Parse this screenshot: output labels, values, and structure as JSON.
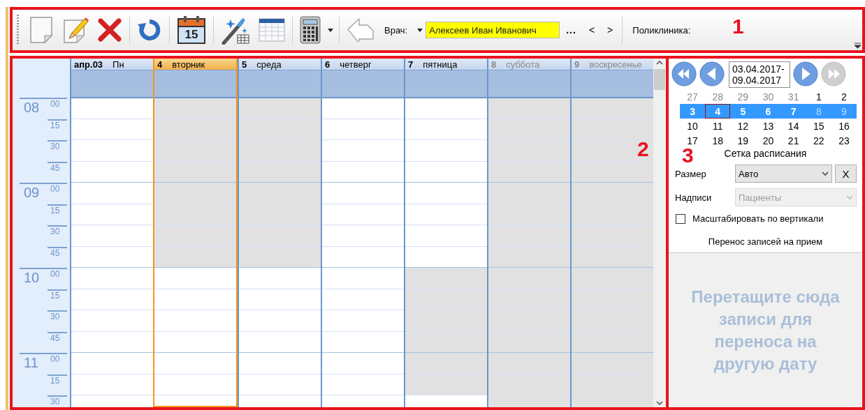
{
  "toolbar": {
    "calendar_day": "15",
    "back_disabled": true,
    "doctor_label": "Врач:",
    "doctor": "Алексеев Иван Иванович",
    "more": "...",
    "prev": "<",
    "next": ">",
    "clinic_label": "Поликлиника:"
  },
  "annotations": [
    "1",
    "2",
    "3"
  ],
  "schedule": {
    "days": [
      {
        "number": "апр.03",
        "name": "Пн",
        "selected": false,
        "weekend": false,
        "blocked": [
          false,
          false,
          false,
          false,
          false,
          false,
          false,
          false,
          false,
          false,
          false,
          false,
          false,
          false,
          false
        ]
      },
      {
        "number": "4",
        "name": "вторник",
        "selected": true,
        "weekend": false,
        "blocked": [
          true,
          true,
          true,
          true,
          true,
          true,
          true,
          true,
          false,
          false,
          false,
          false,
          false,
          false,
          false
        ]
      },
      {
        "number": "5",
        "name": "среда",
        "selected": false,
        "weekend": false,
        "blocked": [
          true,
          true,
          true,
          true,
          true,
          true,
          true,
          true,
          false,
          false,
          false,
          false,
          false,
          false,
          false
        ]
      },
      {
        "number": "6",
        "name": "четверг",
        "selected": false,
        "weekend": false,
        "blocked": [
          false,
          false,
          false,
          false,
          false,
          false,
          false,
          false,
          false,
          false,
          false,
          false,
          false,
          false,
          false
        ]
      },
      {
        "number": "7",
        "name": "пятница",
        "selected": false,
        "weekend": false,
        "blocked": [
          false,
          false,
          false,
          false,
          false,
          false,
          false,
          false,
          true,
          true,
          true,
          true,
          true,
          true,
          false
        ]
      },
      {
        "number": "8",
        "name": "суббота",
        "selected": false,
        "weekend": true,
        "blocked": [
          true,
          true,
          true,
          true,
          true,
          true,
          true,
          true,
          true,
          true,
          true,
          true,
          true,
          true,
          true
        ]
      },
      {
        "number": "9",
        "name": "воскресенье",
        "selected": false,
        "weekend": true,
        "blocked": [
          true,
          true,
          true,
          true,
          true,
          true,
          true,
          true,
          true,
          true,
          true,
          true,
          true,
          true,
          true
        ]
      }
    ],
    "time_axis": [
      {
        "hour": "08",
        "minutes": [
          "00",
          "15",
          "30",
          "45"
        ]
      },
      {
        "hour": "09",
        "minutes": [
          "00",
          "15",
          "30",
          "45"
        ]
      },
      {
        "hour": "10",
        "minutes": [
          "00",
          "15",
          "30",
          "45"
        ]
      },
      {
        "hour": "11",
        "minutes": [
          "00",
          "15",
          "30"
        ]
      }
    ]
  },
  "side_panel": {
    "nav_buttons": [
      {
        "disabled": false
      },
      {
        "disabled": false
      },
      {
        "disabled": false
      },
      {
        "disabled": true
      }
    ],
    "date_range": "03.04.2017-09.04.2017",
    "mini_calendar": {
      "weeks": [
        {
          "selected": false,
          "days": [
            {
              "text": "27",
              "other_month": true,
              "today": false
            },
            {
              "text": "28",
              "other_month": true,
              "today": false
            },
            {
              "text": "29",
              "other_month": true,
              "today": false
            },
            {
              "text": "30",
              "other_month": true,
              "today": false
            },
            {
              "text": "31",
              "other_month": true,
              "today": false
            },
            {
              "text": "1",
              "other_month": false,
              "today": false
            },
            {
              "text": "2",
              "other_month": false,
              "today": false
            }
          ]
        },
        {
          "selected": true,
          "days": [
            {
              "text": "3",
              "other_month": false,
              "today": false
            },
            {
              "text": "4",
              "other_month": false,
              "today": true
            },
            {
              "text": "5",
              "other_month": false,
              "today": false
            },
            {
              "text": "6",
              "other_month": false,
              "today": false
            },
            {
              "text": "7",
              "other_month": false,
              "today": false
            },
            {
              "text": "8",
              "other_month": false,
              "today": false
            },
            {
              "text": "9",
              "other_month": false,
              "today": false
            }
          ]
        },
        {
          "selected": false,
          "days": [
            {
              "text": "10",
              "other_month": false,
              "today": false
            },
            {
              "text": "11",
              "other_month": false,
              "today": false
            },
            {
              "text": "12",
              "other_month": false,
              "today": false
            },
            {
              "text": "13",
              "other_month": false,
              "today": false
            },
            {
              "text": "14",
              "other_month": false,
              "today": false
            },
            {
              "text": "15",
              "other_month": false,
              "today": false
            },
            {
              "text": "16",
              "other_month": false,
              "today": false
            }
          ]
        },
        {
          "selected": false,
          "days": [
            {
              "text": "17",
              "other_month": false,
              "today": false
            },
            {
              "text": "18",
              "other_month": false,
              "today": false
            },
            {
              "text": "19",
              "other_month": false,
              "today": false
            },
            {
              "text": "20",
              "other_month": false,
              "today": false
            },
            {
              "text": "21",
              "other_month": false,
              "today": false
            },
            {
              "text": "22",
              "other_month": false,
              "today": false
            },
            {
              "text": "23",
              "other_month": false,
              "today": false
            }
          ]
        }
      ]
    },
    "grid_title": "Сетка расписания",
    "size_label": "Размер",
    "size_value": "Авто",
    "clear_button": "X",
    "labels_label": "Надписи",
    "labels_value": "Пациенты",
    "labels_disabled": true,
    "scale_label": "Масштабировать по вертикали",
    "scale_checked": false,
    "transfer_title": "Перенос записей на прием",
    "drop_hint": "Перетащите сюда записи для переноса на другую дату"
  }
}
